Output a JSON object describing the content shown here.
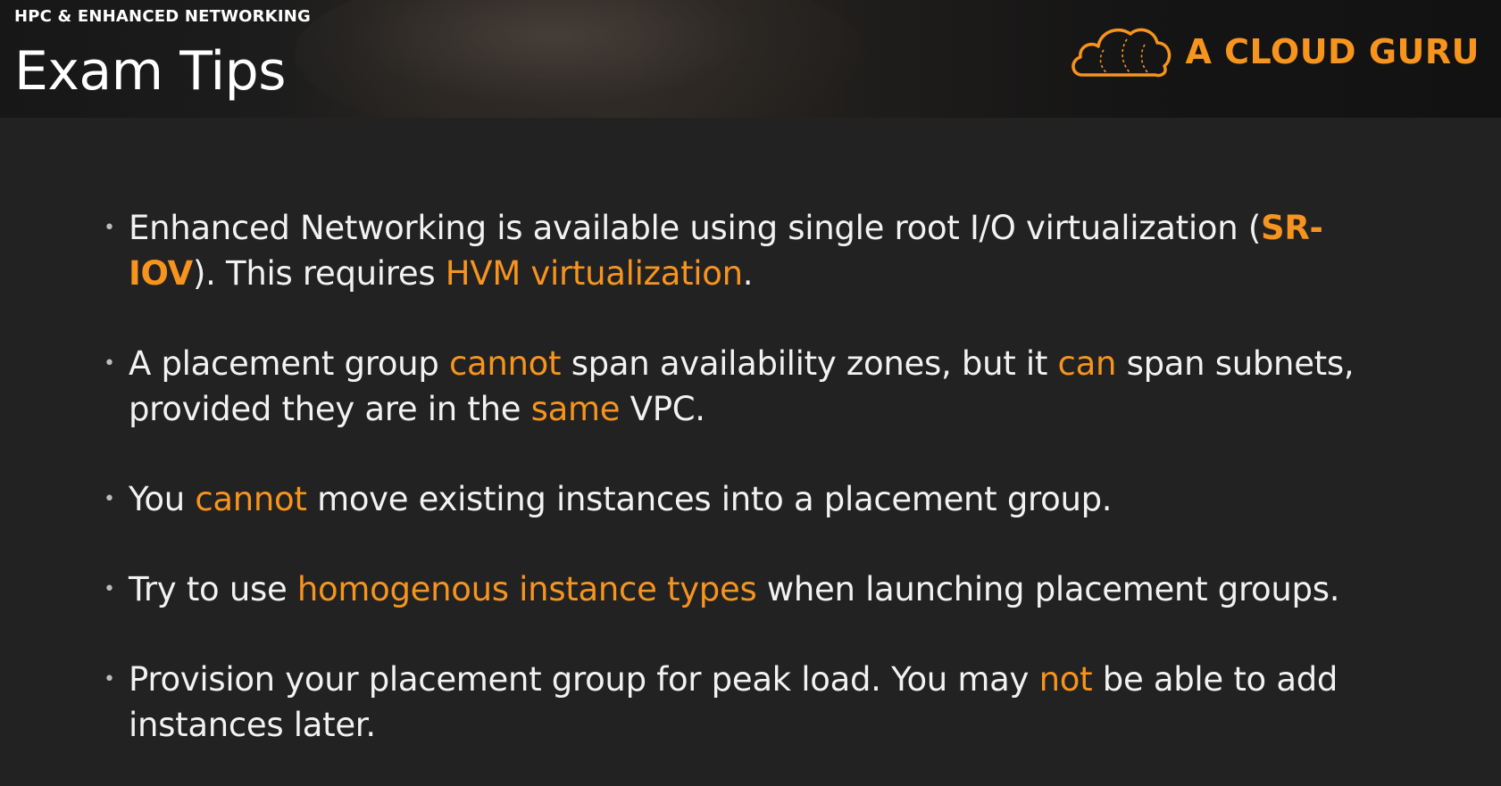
{
  "header": {
    "section_label": "HPC & ENHANCED NETWORKING",
    "title": "Exam Tips",
    "logo_text": "A CLOUD GURU",
    "logo_icon": "cloud-logo-icon",
    "accent_color": "#f7941d"
  },
  "tips": [
    {
      "parts": [
        {
          "text": "Enhanced Networking is available using single root I/O virtualization (",
          "style": "normal"
        },
        {
          "text": "SR-IOV",
          "style": "bold"
        },
        {
          "text": "). This requires ",
          "style": "normal"
        },
        {
          "text": "HVM virtualization",
          "style": "highlight"
        },
        {
          "text": ".",
          "style": "normal"
        }
      ]
    },
    {
      "parts": [
        {
          "text": "A placement group ",
          "style": "normal"
        },
        {
          "text": "cannot",
          "style": "highlight"
        },
        {
          "text": " span availability zones, but it ",
          "style": "normal"
        },
        {
          "text": "can",
          "style": "highlight"
        },
        {
          "text": " span subnets, provided they are in the ",
          "style": "normal"
        },
        {
          "text": "same",
          "style": "highlight"
        },
        {
          "text": " VPC.",
          "style": "normal"
        }
      ]
    },
    {
      "parts": [
        {
          "text": "You ",
          "style": "normal"
        },
        {
          "text": "cannot",
          "style": "highlight"
        },
        {
          "text": " move existing instances into a placement group.",
          "style": "normal"
        }
      ]
    },
    {
      "parts": [
        {
          "text": "Try to use ",
          "style": "normal"
        },
        {
          "text": "homogenous instance types",
          "style": "highlight"
        },
        {
          "text": " when launching placement groups.",
          "style": "normal"
        }
      ]
    },
    {
      "parts": [
        {
          "text": "Provision your placement group for peak load. You may ",
          "style": "normal"
        },
        {
          "text": "not",
          "style": "highlight"
        },
        {
          "text": " be able to add instances later.",
          "style": "normal"
        }
      ]
    }
  ]
}
